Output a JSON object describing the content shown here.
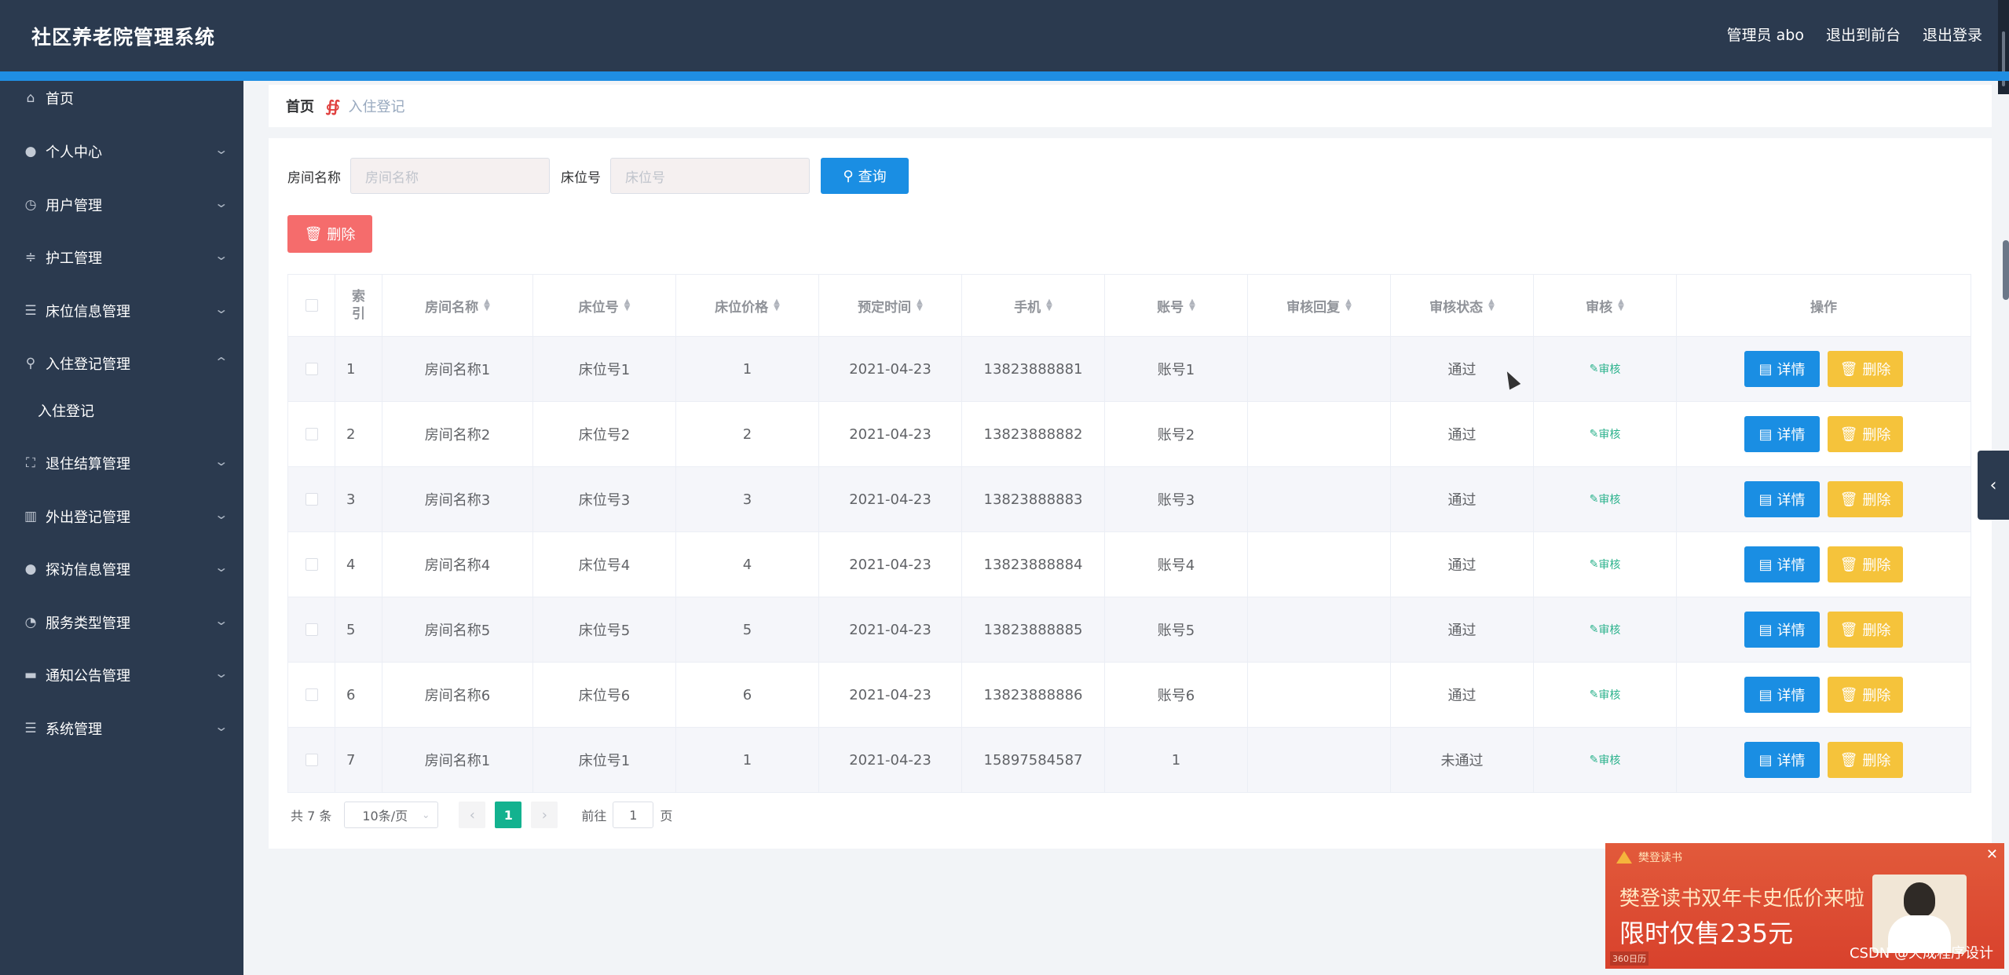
{
  "header": {
    "title": "社区养老院管理系统",
    "admin_label": "管理员 abo",
    "to_frontend": "退出到前台",
    "logout": "退出登录"
  },
  "sidebar": {
    "items": [
      {
        "label": "首页",
        "icon": "home-icon"
      },
      {
        "label": "个人中心",
        "icon": "user-icon"
      },
      {
        "label": "用户管理",
        "icon": "clock-icon"
      },
      {
        "label": "护工管理",
        "icon": "sliders-icon"
      },
      {
        "label": "床位信息管理",
        "icon": "list-icon"
      },
      {
        "label": "入住登记管理",
        "icon": "mic-icon"
      },
      {
        "label": "退住结算管理",
        "icon": "fullscreen-icon"
      },
      {
        "label": "外出登记管理",
        "icon": "bar-chart-icon"
      },
      {
        "label": "探访信息管理",
        "icon": "user-icon"
      },
      {
        "label": "服务类型管理",
        "icon": "compass-icon"
      },
      {
        "label": "通知公告管理",
        "icon": "notebook-icon"
      },
      {
        "label": "系统管理",
        "icon": "list-icon"
      }
    ],
    "submenu": {
      "label": "入住登记"
    }
  },
  "breadcrumb": {
    "home": "首页",
    "separator": "∯",
    "current": "入住登记"
  },
  "search": {
    "room_label": "房间名称",
    "room_placeholder": "房间名称",
    "bed_label": "床位号",
    "bed_placeholder": "床位号",
    "query_button": "查询"
  },
  "toolbar": {
    "delete_label": "删除"
  },
  "table": {
    "headers": {
      "index": "索引",
      "room": "房间名称",
      "bed": "床位号",
      "price": "床位价格",
      "date": "预定时间",
      "phone": "手机",
      "account": "账号",
      "reply": "审核回复",
      "status": "审核状态",
      "audit": "审核",
      "ops": "操作"
    },
    "audit_link": "审核",
    "detail_button": "详情",
    "delete_button": "删除",
    "rows": [
      {
        "index": "1",
        "room": "房间名称1",
        "bed": "床位号1",
        "price": "1",
        "date": "2021-04-23",
        "phone": "13823888881",
        "account": "账号1",
        "reply": "",
        "status": "通过"
      },
      {
        "index": "2",
        "room": "房间名称2",
        "bed": "床位号2",
        "price": "2",
        "date": "2021-04-23",
        "phone": "13823888882",
        "account": "账号2",
        "reply": "",
        "status": "通过"
      },
      {
        "index": "3",
        "room": "房间名称3",
        "bed": "床位号3",
        "price": "3",
        "date": "2021-04-23",
        "phone": "13823888883",
        "account": "账号3",
        "reply": "",
        "status": "通过"
      },
      {
        "index": "4",
        "room": "房间名称4",
        "bed": "床位号4",
        "price": "4",
        "date": "2021-04-23",
        "phone": "13823888884",
        "account": "账号4",
        "reply": "",
        "status": "通过"
      },
      {
        "index": "5",
        "room": "房间名称5",
        "bed": "床位号5",
        "price": "5",
        "date": "2021-04-23",
        "phone": "13823888885",
        "account": "账号5",
        "reply": "",
        "status": "通过"
      },
      {
        "index": "6",
        "room": "房间名称6",
        "bed": "床位号6",
        "price": "6",
        "date": "2021-04-23",
        "phone": "13823888886",
        "account": "账号6",
        "reply": "",
        "status": "通过"
      },
      {
        "index": "7",
        "room": "房间名称1",
        "bed": "床位号1",
        "price": "1",
        "date": "2021-04-23",
        "phone": "15897584587",
        "account": "1",
        "reply": "",
        "status": "未通过"
      }
    ]
  },
  "pagination": {
    "total": "共 7 条",
    "page_size": "10条/页",
    "current_page": "1",
    "goto_label": "前往",
    "goto_value": "1",
    "page_unit": "页"
  },
  "ad": {
    "brand": "樊登读书",
    "line1": "樊登读书双年卡史低价来啦",
    "line2": "限时仅售235元",
    "tag": "360日历"
  },
  "watermark": "CSDN @天成程序设计",
  "colors": {
    "header_bg": "#2b3a4f",
    "accent": "#1f8ee3",
    "primary": "#1a8ee3",
    "danger": "#f56c6c",
    "warning": "#f5c33b",
    "success": "#13b28f"
  }
}
